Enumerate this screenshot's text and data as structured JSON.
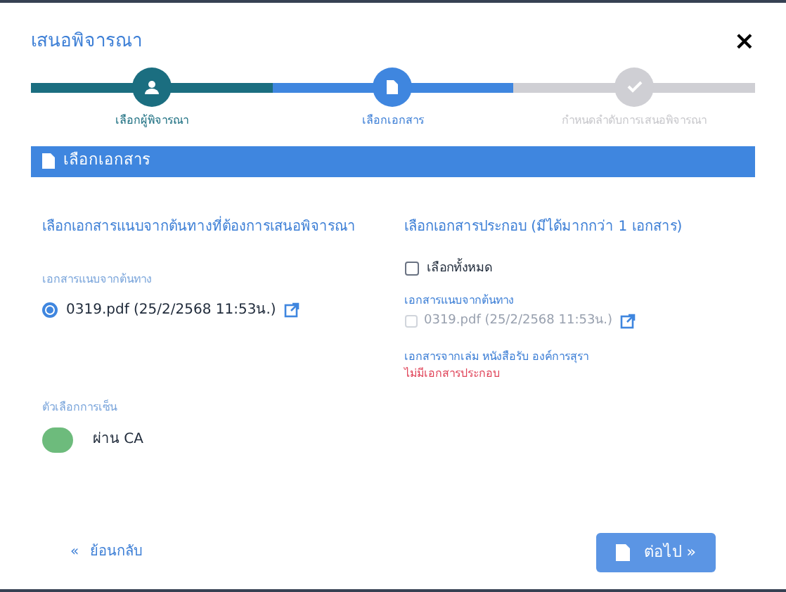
{
  "dialog": {
    "title": "เสนอพิจารณา",
    "close": "×"
  },
  "steps": [
    {
      "label": "เลือกผู้พิจารณา",
      "kind": "done"
    },
    {
      "label": "เลือกเอกสาร",
      "kind": "active"
    },
    {
      "label": "กำหนดลำดับการเสนอพิจารณา",
      "kind": "pending"
    }
  ],
  "section": {
    "title": "เลือกเอกสาร"
  },
  "left": {
    "heading": "เลือกเอกสารแนบจากต้นทางที่ต้องการเสนอพิจารณา",
    "group_label": "เอกสารแนบจากต้นทาง",
    "files": [
      {
        "name": "0319.pdf (25/2/2568 11:53น.)",
        "selected": true
      }
    ],
    "sign_label": "ตัวเลือกการเซ็น",
    "sign_option": {
      "label": "ผ่าน CA",
      "on": true
    }
  },
  "right": {
    "heading": "เลือกเอกสารประกอบ (มีได้มากกว่า 1 เอกสาร)",
    "select_all": {
      "label": "เลือกทั้งหมด",
      "checked": false
    },
    "group_label": "เอกสารแนบจากต้นทาง",
    "files": [
      {
        "name": "0319.pdf (25/2/2568 11:53น.)",
        "checked": false,
        "disabled": true
      }
    ],
    "book_label": "เอกสารจากเล่ม หนังสือรับ องค์การสุรา",
    "empty_note": "ไม่มีเอกสารประกอบ"
  },
  "footer": {
    "back": "ย้อนกลับ",
    "back_icon": "«",
    "next": "ต่อไป",
    "next_icon": "»"
  }
}
